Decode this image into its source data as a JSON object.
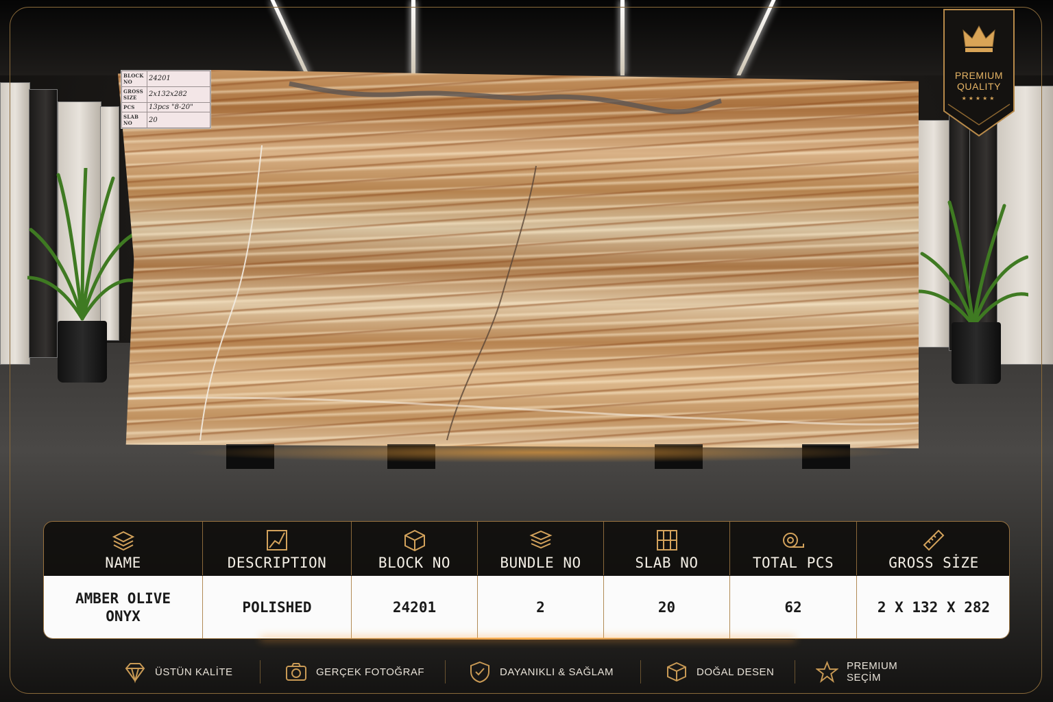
{
  "slab_tag": {
    "rows": [
      {
        "key": "BLOCK NO",
        "value": "24201"
      },
      {
        "key": "GROSS SIZE",
        "value": "2x132x282"
      },
      {
        "key": "PCS",
        "value": "13pcs  \"8-20\""
      },
      {
        "key": "SLAB NO",
        "value": "20"
      }
    ]
  },
  "badge": {
    "line1": "PREMIUM",
    "line2": "QUALITY",
    "stars": "★★★★★",
    "icon": "crown-icon"
  },
  "table": {
    "headers": [
      {
        "label": "NAME",
        "icon": "layers-icon"
      },
      {
        "label": "DESCRIPTION",
        "icon": "marble-texture-icon"
      },
      {
        "label": "BLOCK NO",
        "icon": "cube-icon"
      },
      {
        "label": "BUNDLE NO",
        "icon": "stack-icon"
      },
      {
        "label": "SLAB NO",
        "icon": "grid-icon"
      },
      {
        "label": "TOTAL PCS",
        "icon": "tape-measure-icon"
      },
      {
        "label": "GROSS SİZE",
        "icon": "ruler-icon"
      }
    ],
    "values": [
      "AMBER OLIVE ONYX",
      "POLISHED",
      "24201",
      "2",
      "20",
      "62",
      "2 X 132 X 282"
    ]
  },
  "footer": [
    {
      "label": "ÜSTÜN KALİTE",
      "icon": "diamond-icon"
    },
    {
      "label": "GERÇEK FOTOĞRAF",
      "icon": "camera-icon"
    },
    {
      "label": "DAYANIKLI & SAĞLAM",
      "icon": "shield-check-icon"
    },
    {
      "label": "DOĞAL DESEN",
      "icon": "stone-box-icon"
    },
    {
      "label": "PREMIUM SEÇİM",
      "icon": "star-icon"
    }
  ],
  "colors": {
    "accent_gold": "#c99a55",
    "table_border": "#9b7440",
    "dark_bg": "#0c0b0a"
  }
}
